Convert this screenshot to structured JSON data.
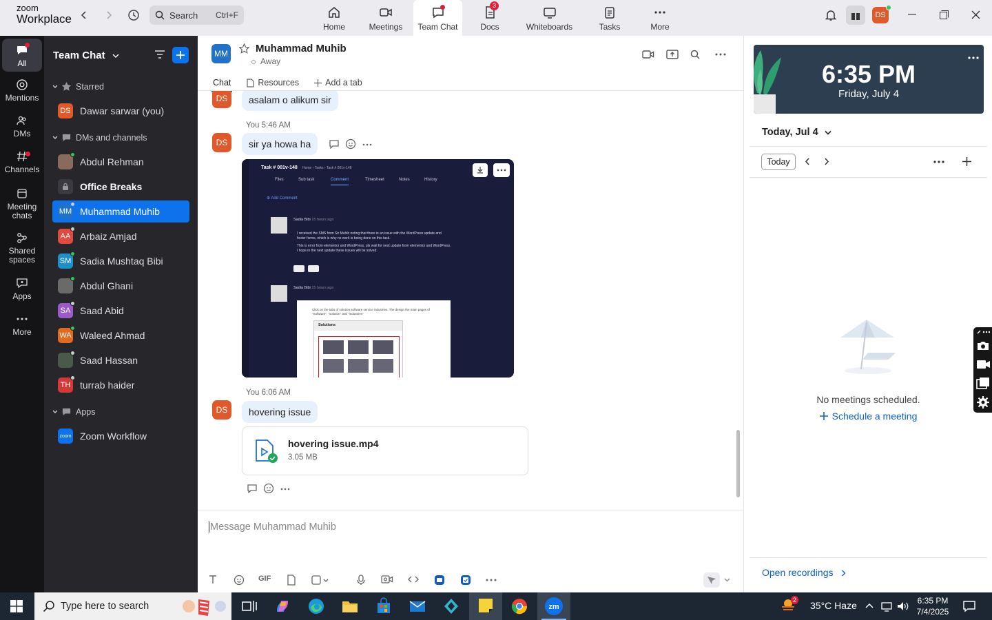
{
  "app": {
    "logo_line1": "zoom",
    "logo_line2": "Workplace"
  },
  "search": {
    "label": "Search",
    "shortcut": "Ctrl+F"
  },
  "nav": {
    "home": "Home",
    "meetings": "Meetings",
    "team_chat": "Team Chat",
    "docs": "Docs",
    "docs_badge": "3",
    "whiteboards": "Whiteboards",
    "tasks": "Tasks",
    "more": "More"
  },
  "profile": {
    "initials": "DS"
  },
  "rail": {
    "all": "All",
    "mentions": "Mentions",
    "dms": "DMs",
    "channels": "Channels",
    "meeting_chats_1": "Meeting",
    "meeting_chats_2": "chats",
    "shared_1": "Shared",
    "shared_2": "spaces",
    "apps": "Apps",
    "more": "More"
  },
  "sidebar": {
    "title": "Team Chat",
    "sections": {
      "starred": "Starred",
      "dms": "DMs and channels",
      "apps": "Apps"
    },
    "starred": [
      {
        "initials": "DS",
        "name": "Dawar sarwar (you)",
        "color": "#e0592a"
      }
    ],
    "dms": [
      {
        "initials": "",
        "name": "Abdul Rehman",
        "color": "#8a6a5c",
        "status": "#34c759"
      },
      {
        "initials": "",
        "name": "Office Breaks",
        "color": "#3a3a40",
        "status": ""
      },
      {
        "initials": "MM",
        "name": "Muhammad Muhib",
        "color": "#1f72c7",
        "status": "#cccccc"
      },
      {
        "initials": "AA",
        "name": "Arbaiz Amjad",
        "color": "#e04a3f",
        "status": "#cccccc"
      },
      {
        "initials": "SM",
        "name": "Sadia Mushtaq Bibi",
        "color": "#1f8fc7",
        "status": "#34c759"
      },
      {
        "initials": "",
        "name": "Abdul Ghani",
        "color": "#6a6a6a",
        "status": "#34c759"
      },
      {
        "initials": "SA",
        "name": "Saad Abid",
        "color": "#9b5bc7",
        "status": "#cccccc"
      },
      {
        "initials": "WA",
        "name": "Waleed Ahmad",
        "color": "#e06a1f",
        "status": "#34c759"
      },
      {
        "initials": "",
        "name": "Saad Hassan",
        "color": "#4a5a4a",
        "status": "#cccccc"
      },
      {
        "initials": "TH",
        "name": "turrab haider",
        "color": "#d23a3a",
        "status": "#cccccc"
      }
    ],
    "apps": [
      {
        "initials": "zoom",
        "name": "Zoom Workflow",
        "color": "#0e72ed"
      }
    ]
  },
  "chat": {
    "avatar": "MM",
    "name": "Muhammad Muhib",
    "status": "Away",
    "tabs": {
      "chat": "Chat",
      "resources": "Resources",
      "add": "Add a tab"
    },
    "messages": {
      "m1_avatar": "DS",
      "m1_text": "asalam o alikum sir",
      "m2_meta": "You 5:46 AM",
      "m2_avatar": "DS",
      "m2_text": "sir ya howa ha",
      "m3_meta": "You 6:06 AM",
      "m3_avatar": "DS",
      "m3_text": "hovering issue"
    },
    "file": {
      "name": "hovering issue.mp4",
      "size": "3.05 MB"
    },
    "placeholder": "Message Muhammad Muhib",
    "gif": "GIF"
  },
  "attachment": {
    "task_title": "Task # 001v-148",
    "breadcrumb": "Home › Tasks › Task # 001v-148",
    "tabs": [
      "Files",
      "Sub task",
      "Comment",
      "Timesheet",
      "Notes",
      "History"
    ],
    "add_comment": "⊕ Add Comment",
    "c1_author": "Sadia Bibi",
    "c1_time": "15 hours ago",
    "c1_line1": "I received the SMS from Sir Muhib noting that there is an issue with the WordPress update and",
    "c1_line2": "footer forms, which is why no work is being done on this task.",
    "c1_line3": "This is error from elementor and WordPress, pls wait for next update from elementor and WordPress.",
    "c1_line4": "I hope in the next update these issues will be solved.",
    "c2_author": "Sadia Bibi",
    "c2_time": "15 hours ago",
    "inner_text1": "Click on the tabs of solution software service industries. The design the main pages of",
    "inner_text2": "\"Software\", \"solution\" and \"industries\"",
    "inner_heading": "Solutions"
  },
  "right": {
    "time": "6:35 PM",
    "date": "Friday, July 4",
    "today_label": "Today, Jul 4",
    "today_btn": "Today",
    "no_meetings": "No meetings scheduled.",
    "schedule": "Schedule a meeting",
    "open_recordings": "Open recordings"
  },
  "taskbar": {
    "search": "Type here to search",
    "weather_badge": "2",
    "weather": "35°C  Haze",
    "time": "6:35 PM",
    "date": "7/4/2025"
  }
}
